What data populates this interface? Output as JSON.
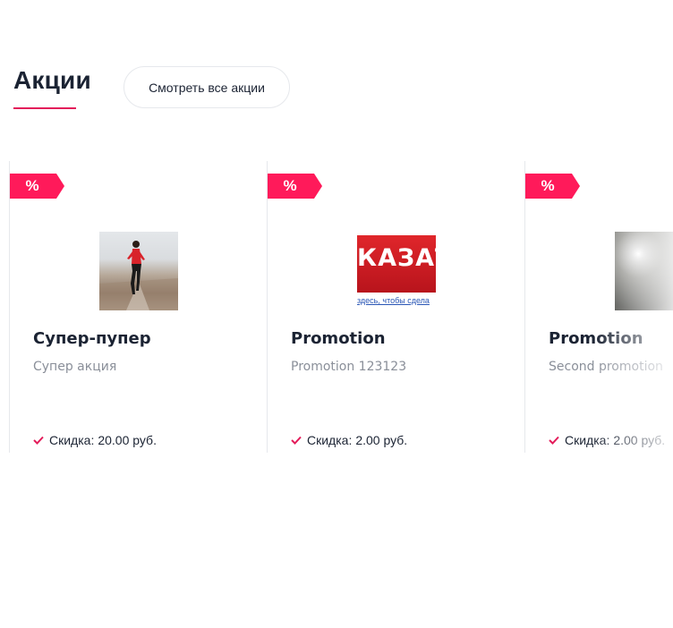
{
  "section": {
    "title": "Акции",
    "view_all_label": "Смотреть все акции"
  },
  "colors": {
    "accent": "#ff1a5a",
    "title_underline": "#e31c5a",
    "text": "#1b2333",
    "muted": "#8a8f99",
    "border": "#e6e8ec"
  },
  "promotions": [
    {
      "badge": "%",
      "image": "runner-photo",
      "title": "Супер-пупер",
      "description": "Супер акция",
      "discount_label": "Скидка:",
      "discount_value": "20.00 руб."
    },
    {
      "badge": "%",
      "image": "red-banner",
      "banner_text": "КАЗАТ",
      "banner_subtext": "здесь, чтобы сдела",
      "title": "Promotion",
      "description": "Promotion 123123",
      "discount_label": "Скидка:",
      "discount_value": "2.00 руб."
    },
    {
      "badge": "%",
      "image": "light-photo",
      "title": "Promotion",
      "description": "Second promotion",
      "discount_label": "Скидка:",
      "discount_value": "2.00 руб."
    }
  ],
  "icons": {
    "discount": "check-icon",
    "badge": "percent-icon"
  }
}
